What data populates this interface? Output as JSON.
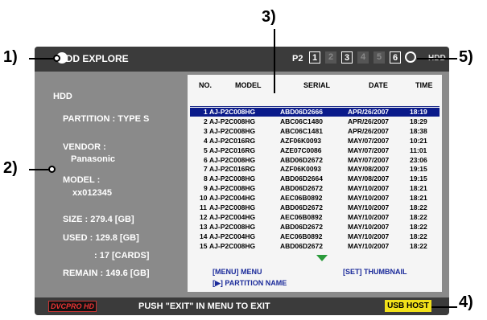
{
  "screen": {
    "title": "HDD EXPLORE",
    "p2_label": "P2",
    "slots": [
      "1",
      "2",
      "3",
      "4",
      "5",
      "6"
    ],
    "slot_states": [
      "active",
      "dim",
      "active",
      "dim",
      "dim",
      "active"
    ],
    "hdd_label": "HDD"
  },
  "left_panel": {
    "heading": "HDD",
    "partition": "PARTITION : TYPE S",
    "vendor_label": "VENDOR :",
    "vendor_value": "Panasonic",
    "model_label": "MODEL :",
    "model_value": "xx012345",
    "size": "SIZE : 279.4 [GB]",
    "used": "USED : 129.8 [GB]",
    "cards": ": 17 [CARDS]",
    "remain": "REMAIN : 149.6 [GB]"
  },
  "table": {
    "headers": [
      "NO.",
      "MODEL",
      "SERIAL",
      "DATE",
      "TIME"
    ],
    "rows": [
      [
        "1",
        "AJ-P2C008HG",
        "ABD06D2666",
        "APR/26/2007",
        "18:19"
      ],
      [
        "2",
        "AJ-P2C008HG",
        "ABC06C1480",
        "APR/26/2007",
        "18:29"
      ],
      [
        "3",
        "AJ-P2C008HG",
        "ABC06C1481",
        "APR/26/2007",
        "18:38"
      ],
      [
        "4",
        "AJ-P2C016RG",
        "AZF06K0093",
        "MAY/07/2007",
        "10:21"
      ],
      [
        "5",
        "AJ-P2C016RG",
        "AZE07C0086",
        "MAY/07/2007",
        "11:01"
      ],
      [
        "6",
        "AJ-P2C008HG",
        "ABD06D2672",
        "MAY/07/2007",
        "23:06"
      ],
      [
        "7",
        "AJ-P2C016RG",
        "AZF06K0093",
        "MAY/08/2007",
        "19:15"
      ],
      [
        "8",
        "AJ-P2C008HG",
        "ABD06D2664",
        "MAY/08/2007",
        "19:15"
      ],
      [
        "9",
        "AJ-P2C008HG",
        "ABD06D2672",
        "MAY/10/2007",
        "18:21"
      ],
      [
        "10",
        "AJ-P2C004HG",
        "AEC06B0892",
        "MAY/10/2007",
        "18:21"
      ],
      [
        "11",
        "AJ-P2C008HG",
        "ABD06D2672",
        "MAY/10/2007",
        "18:22"
      ],
      [
        "12",
        "AJ-P2C004HG",
        "AEC06B0892",
        "MAY/10/2007",
        "18:22"
      ],
      [
        "13",
        "AJ-P2C008HG",
        "ABD06D2672",
        "MAY/10/2007",
        "18:22"
      ],
      [
        "14",
        "AJ-P2C004HG",
        "AEC06B0892",
        "MAY/10/2007",
        "18:22"
      ],
      [
        "15",
        "AJ-P2C008HG",
        "ABD06D2672",
        "MAY/10/2007",
        "18:22"
      ]
    ],
    "footer_menu": "[MENU] MENU",
    "footer_set": "[SET] THUMBNAIL",
    "footer_partition": "[▶] PARTITION NAME"
  },
  "bottom": {
    "logo": "DVCPRO HD",
    "message": "PUSH \"EXIT\" IN MENU TO EXIT",
    "usb_label": "USB HOST"
  },
  "callouts": [
    "1)",
    "2)",
    "3)",
    "4)",
    "5)"
  ],
  "colors": {
    "screen_bg": "#8a8a8a",
    "bar_bg": "#3b3b3b",
    "selection": "#0a1a8a",
    "usb_badge": "#f2e11a",
    "footer_text": "#1a2a9a",
    "arrow": "#2a9a3a"
  }
}
